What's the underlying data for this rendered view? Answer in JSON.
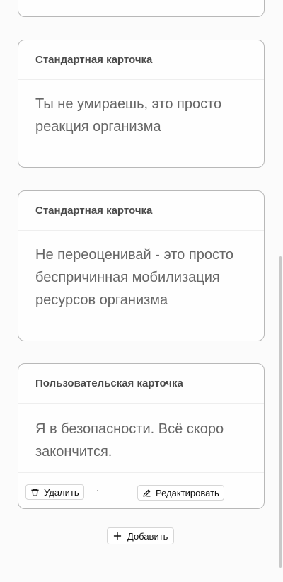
{
  "cards": [
    {
      "header": "Стандартная карточка",
      "text": "Ты не умираешь, это просто реакция организма"
    },
    {
      "header": "Стандартная карточка",
      "text": "Не переоценивай - это просто беспричинная мобилизация ресурсов организма"
    },
    {
      "header": "Пользовательская карточка",
      "text": "Я в безопасности. Всё скоро закончится.",
      "delete_label": "Удалить",
      "edit_label": "Редактировать"
    }
  ],
  "add_label": "Добавить",
  "icons": {
    "delete": "trash-icon",
    "edit": "pencil-icon",
    "add": "plus-icon"
  }
}
